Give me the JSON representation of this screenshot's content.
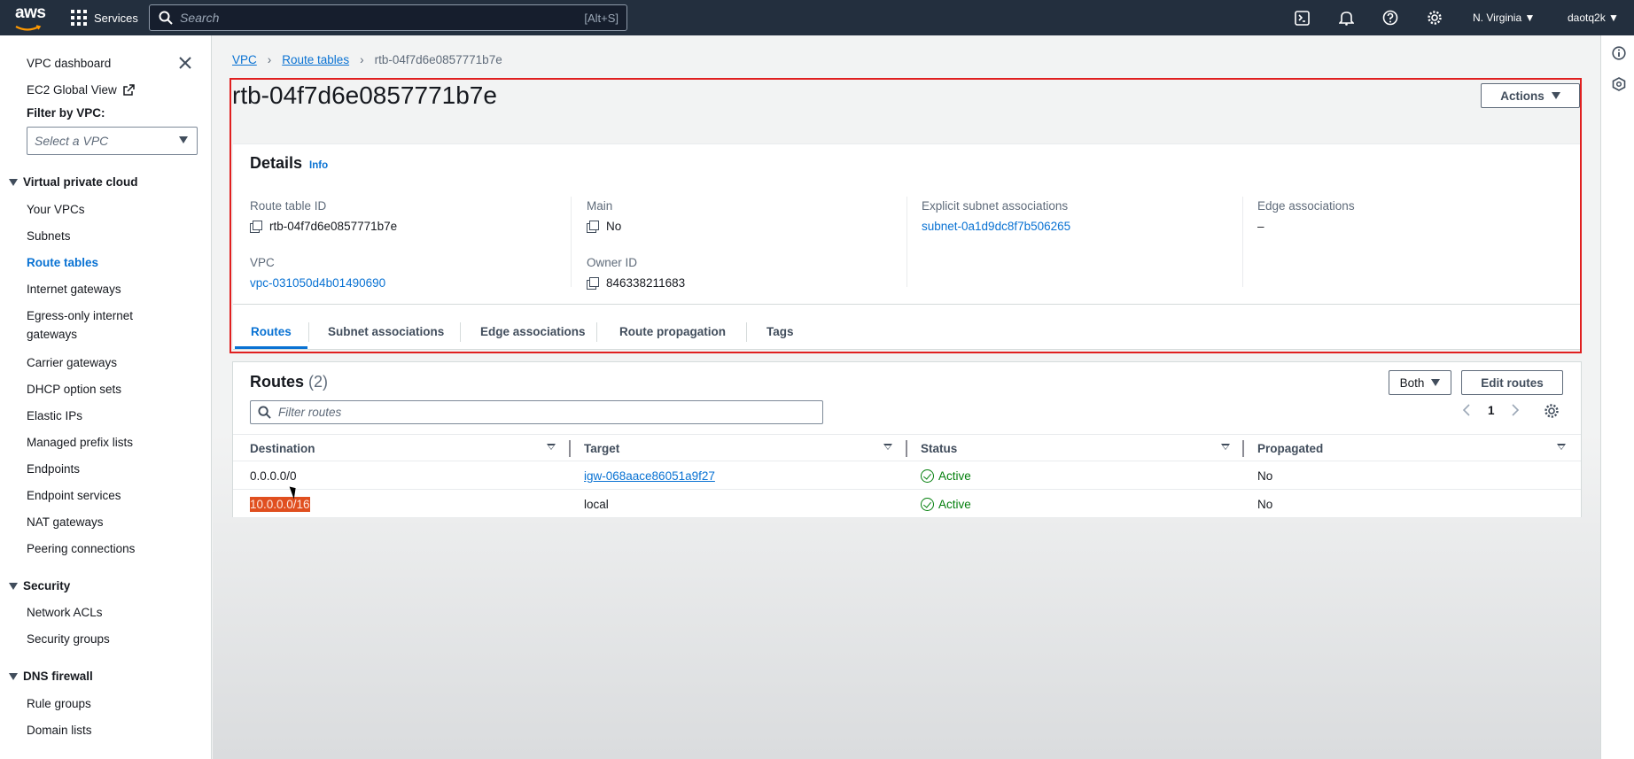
{
  "topbar": {
    "logo_text": "aws",
    "services_label": "Services",
    "search_placeholder": "Search",
    "search_shortcut": "[Alt+S]",
    "region": "N. Virginia",
    "user": "daotq2k"
  },
  "sidebar": {
    "vpc_dashboard": "VPC dashboard",
    "ec2_global_view": "EC2 Global View",
    "filter_label": "Filter by VPC:",
    "filter_placeholder": "Select a VPC",
    "sections": [
      {
        "title": "Virtual private cloud",
        "items": [
          "Your VPCs",
          "Subnets",
          "Route tables",
          "Internet gateways",
          "Egress-only internet",
          "gateways",
          "Carrier gateways",
          "DHCP option sets",
          "Elastic IPs",
          "Managed prefix lists",
          "Endpoints",
          "Endpoint services",
          "NAT gateways",
          "Peering connections"
        ]
      },
      {
        "title": "Security",
        "items": [
          "Network ACLs",
          "Security groups"
        ]
      },
      {
        "title": "DNS firewall",
        "items": [
          "Rule groups",
          "Domain lists"
        ]
      }
    ],
    "active_item": "Route tables"
  },
  "breadcrumb": {
    "items": [
      "VPC",
      "Route tables"
    ],
    "current": "rtb-04f7d6e0857771b7e"
  },
  "page_title": "rtb-04f7d6e0857771b7e",
  "actions_label": "Actions",
  "details": {
    "title": "Details",
    "info": "Info",
    "route_table_id_label": "Route table ID",
    "route_table_id": "rtb-04f7d6e0857771b7e",
    "vpc_label": "VPC",
    "vpc": "vpc-031050d4b01490690",
    "main_label": "Main",
    "main": "No",
    "owner_label": "Owner ID",
    "owner": "846338211683",
    "explicit_label": "Explicit subnet associations",
    "explicit": "subnet-0a1d9dc8f7b506265",
    "edge_label": "Edge associations",
    "edge": "–"
  },
  "tabs": [
    "Routes",
    "Subnet associations",
    "Edge associations",
    "Route propagation",
    "Tags"
  ],
  "routes": {
    "title": "Routes",
    "count": "(2)",
    "both_label": "Both",
    "edit_label": "Edit routes",
    "filter_placeholder": "Filter routes",
    "page": "1",
    "columns": [
      "Destination",
      "Target",
      "Status",
      "Propagated"
    ],
    "rows": [
      {
        "destination": "0.0.0.0/0",
        "target": "igw-068aace86051a9f27",
        "status": "Active",
        "propagated": "No"
      },
      {
        "destination": "10.0.0.0/16",
        "target": "local",
        "status": "Active",
        "propagated": "No"
      }
    ]
  },
  "colors": {
    "accent": "#0972d3",
    "topbar": "#232f3e",
    "highlight_box": "#e01f1f",
    "active_status": "#037f0c",
    "selection": "#e04f1f"
  }
}
